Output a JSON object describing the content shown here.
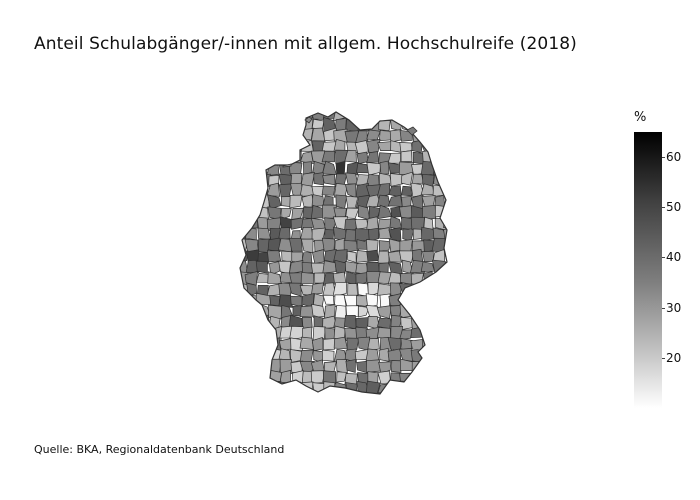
{
  "header": {
    "title": "Anteil Schulabgänger/-innen mit allgem. Hochschulreife (2018)"
  },
  "colorbar": {
    "title": "%",
    "min": 10,
    "max": 65,
    "ticks": [
      "60",
      "50",
      "40",
      "30",
      "20"
    ],
    "tick_values": [
      60,
      50,
      40,
      30,
      20
    ],
    "colors": [
      "#ffffff",
      "#000000"
    ]
  },
  "footer": {
    "source": "Quelle: BKA, Regionaldatenbank Deutschland"
  },
  "map": {
    "region": "Germany",
    "unit_type": "districts",
    "background": "#ffffff",
    "border_color": "#333333"
  }
}
